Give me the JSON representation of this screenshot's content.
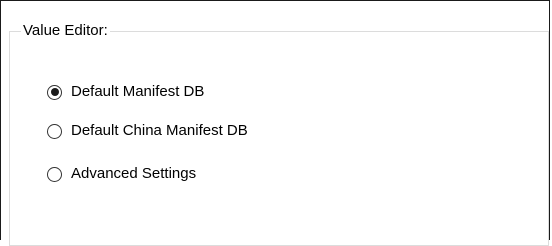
{
  "group": {
    "title": "Value Editor:"
  },
  "options": [
    {
      "label": "Default Manifest DB",
      "selected": true
    },
    {
      "label": "Default China Manifest DB",
      "selected": false
    },
    {
      "label": "Advanced Settings",
      "selected": false
    }
  ]
}
